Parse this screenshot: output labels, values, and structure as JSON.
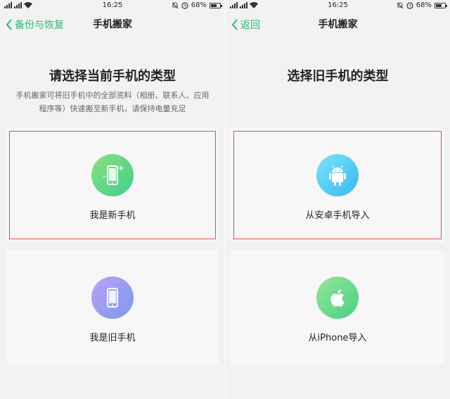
{
  "status_bar": {
    "time": "16:25",
    "battery": "68%",
    "battery_level": 0.68
  },
  "left_screen": {
    "nav": {
      "back_label": "备份与恢复",
      "title": "手机搬家"
    },
    "heading": "请选择当前手机的类型",
    "description": "手机搬家可将旧手机中的全部资料（相册、联系人、应用程序等）快速搬至新手机，请保持电量充足",
    "options": [
      {
        "label": "我是新手机",
        "icon": "new-phone-icon",
        "color": "#3ccf8e"
      },
      {
        "label": "我是旧手机",
        "icon": "old-phone-icon",
        "color": "#8a9bf0"
      }
    ]
  },
  "right_screen": {
    "nav": {
      "back_label": "返回",
      "title": "手机搬家"
    },
    "heading": "选择旧手机的类型",
    "options": [
      {
        "label": "从安卓手机导入",
        "icon": "android-icon",
        "color": "#39b9f2"
      },
      {
        "label": "从iPhone导入",
        "icon": "apple-icon",
        "color": "#48cf86"
      }
    ]
  },
  "colors": {
    "accent": "#2bb673",
    "highlight_border": "#d9534f",
    "background": "#f2f2f2"
  }
}
